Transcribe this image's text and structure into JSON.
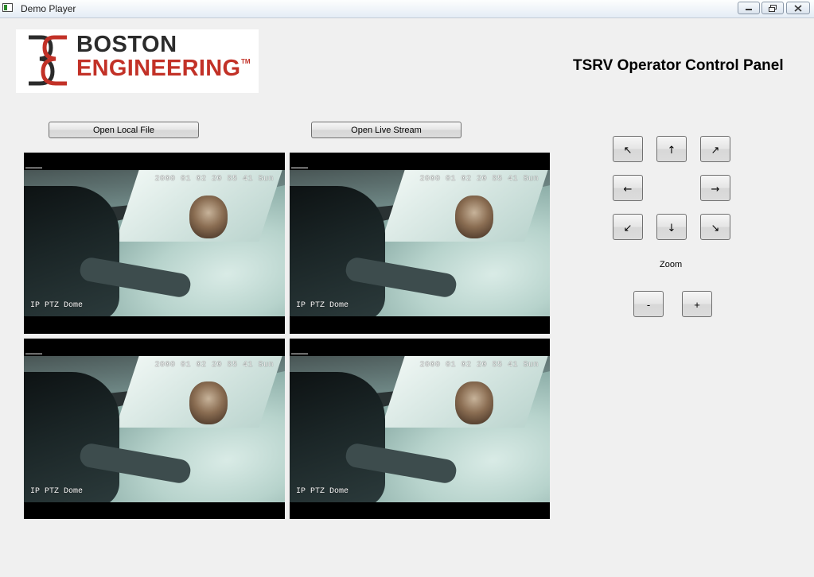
{
  "window": {
    "title": "Demo Player",
    "controls": {
      "minimize": "minimize-icon",
      "maximize": "restore-icon",
      "close": "close-icon"
    }
  },
  "logo": {
    "line1": "BOSTON",
    "line2": "ENGINEERING",
    "trademark": "TM",
    "colors": {
      "dark": "#2b2b2b",
      "red": "#c23127"
    }
  },
  "panel_title": "TSRV Operator Control Panel",
  "toolbar": {
    "open_local_file": "Open Local File",
    "open_live_stream": "Open Live Stream"
  },
  "feeds": [
    {
      "timestamp": "2000 01 02 20 55 41 Sun",
      "camera": "IP PTZ Dome"
    },
    {
      "timestamp": "2000 01 02 20 55 41 Sun",
      "camera": "IP PTZ Dome"
    },
    {
      "timestamp": "2000 01 02 20 55 41 Sun",
      "camera": "IP PTZ Dome"
    },
    {
      "timestamp": "2000 01 02 20 55 41 Sun",
      "camera": "IP PTZ Dome"
    }
  ],
  "ptz": {
    "up_left": "↖",
    "up": "↑",
    "up_right": "↗",
    "left": "←",
    "right": "→",
    "down_left": "↙",
    "down": "↓",
    "down_right": "↘"
  },
  "zoom": {
    "label": "Zoom",
    "out": "-",
    "in": "+"
  }
}
